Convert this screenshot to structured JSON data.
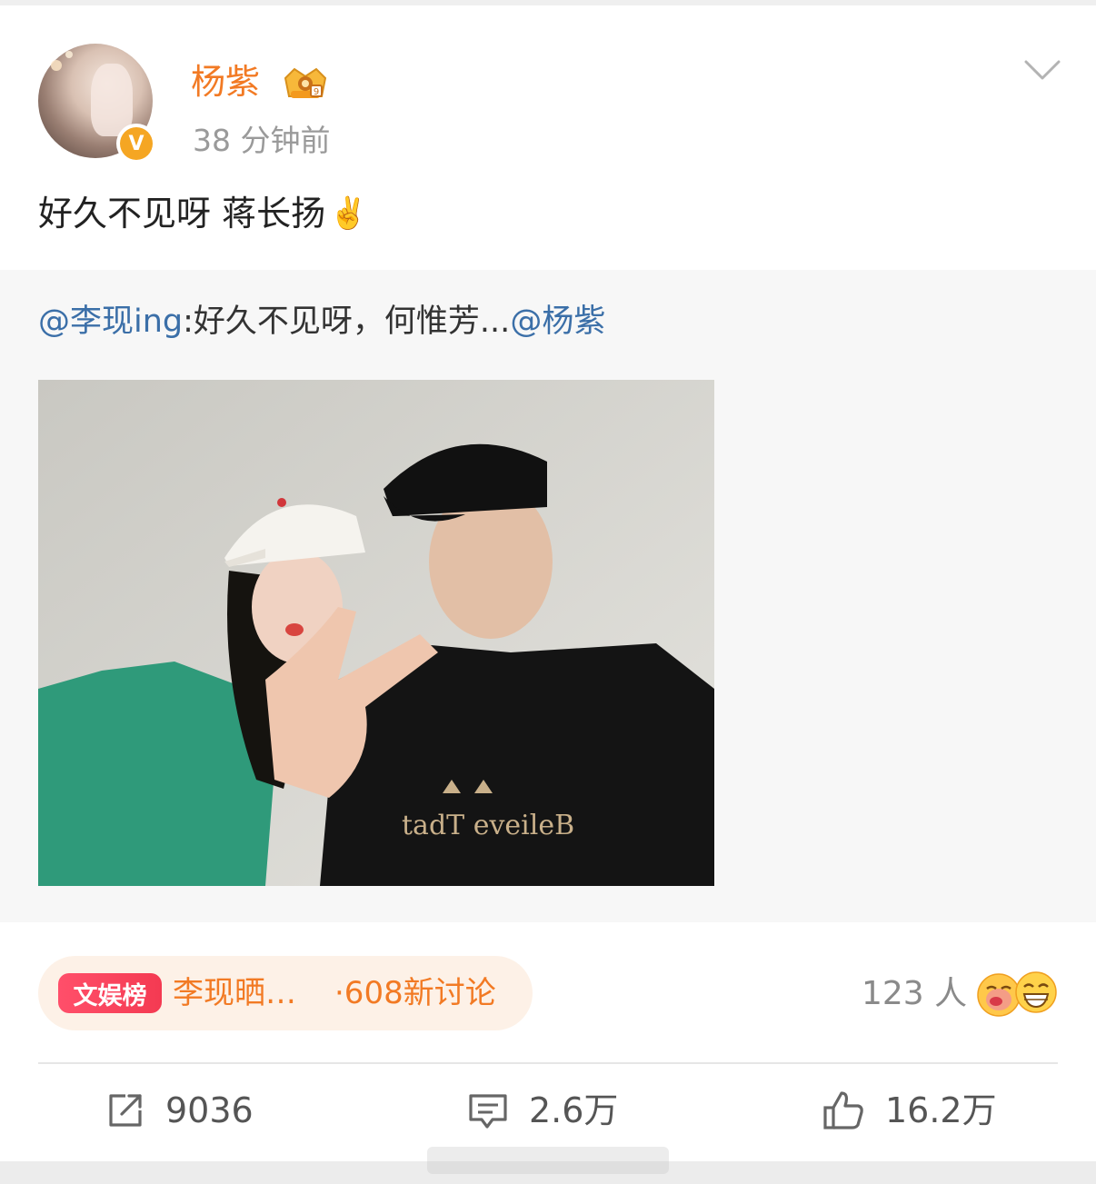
{
  "post": {
    "author": "杨紫",
    "time": "38 分钟前",
    "text": "好久不见呀 蒋长扬",
    "text_emoji": "✌️",
    "icons": {
      "avatar_badge": "verified-v-icon",
      "member": "crown-member-icon",
      "menu": "chevron-down-icon"
    }
  },
  "repost": {
    "mention_user": "@李现ing",
    "separator": ":",
    "text": "好久不见呀，何惟芳...",
    "mention_author": "@杨紫"
  },
  "topic": {
    "tag": "文娱榜",
    "title": "李现晒…",
    "count": "·608新讨论"
  },
  "reactions": {
    "count": "123 人",
    "emojis": [
      "kiss-face-emoji",
      "grin-face-emoji"
    ]
  },
  "actions": {
    "repost": "9036",
    "comment": "2.6万",
    "like": "16.2万"
  },
  "colors": {
    "username": "#f27a24",
    "mention": "#3b6fa8",
    "topic_tag": "#f43a52",
    "topic_bg": "#fdf1e7"
  }
}
